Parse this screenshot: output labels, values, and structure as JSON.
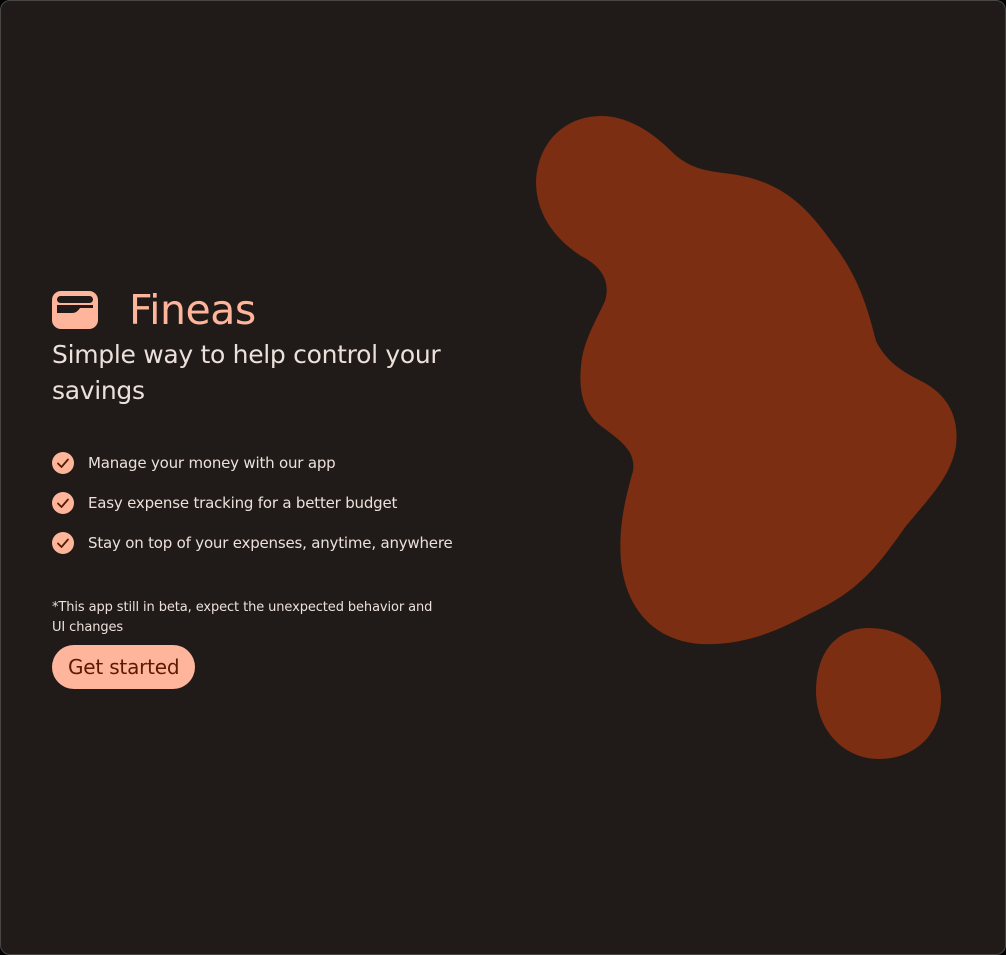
{
  "colors": {
    "background": "#201b18",
    "accent": "#ffb59b",
    "blob": "#7b2e12",
    "text": "#ece0db",
    "button_text": "#5c1a00"
  },
  "brand": {
    "icon": "wallet-icon",
    "name": "Fineas"
  },
  "tagline": "Simple way to help control your savings",
  "features": [
    {
      "icon": "check-circle-icon",
      "text": "Manage your money with our app"
    },
    {
      "icon": "check-circle-icon",
      "text": "Easy expense tracking for a better budget"
    },
    {
      "icon": "check-circle-icon",
      "text": "Stay on top of your expenses, anytime, anywhere"
    }
  ],
  "beta_note": "*This app still in beta, expect the unexpected behavior and UI changes",
  "cta": {
    "label": "Get started"
  }
}
